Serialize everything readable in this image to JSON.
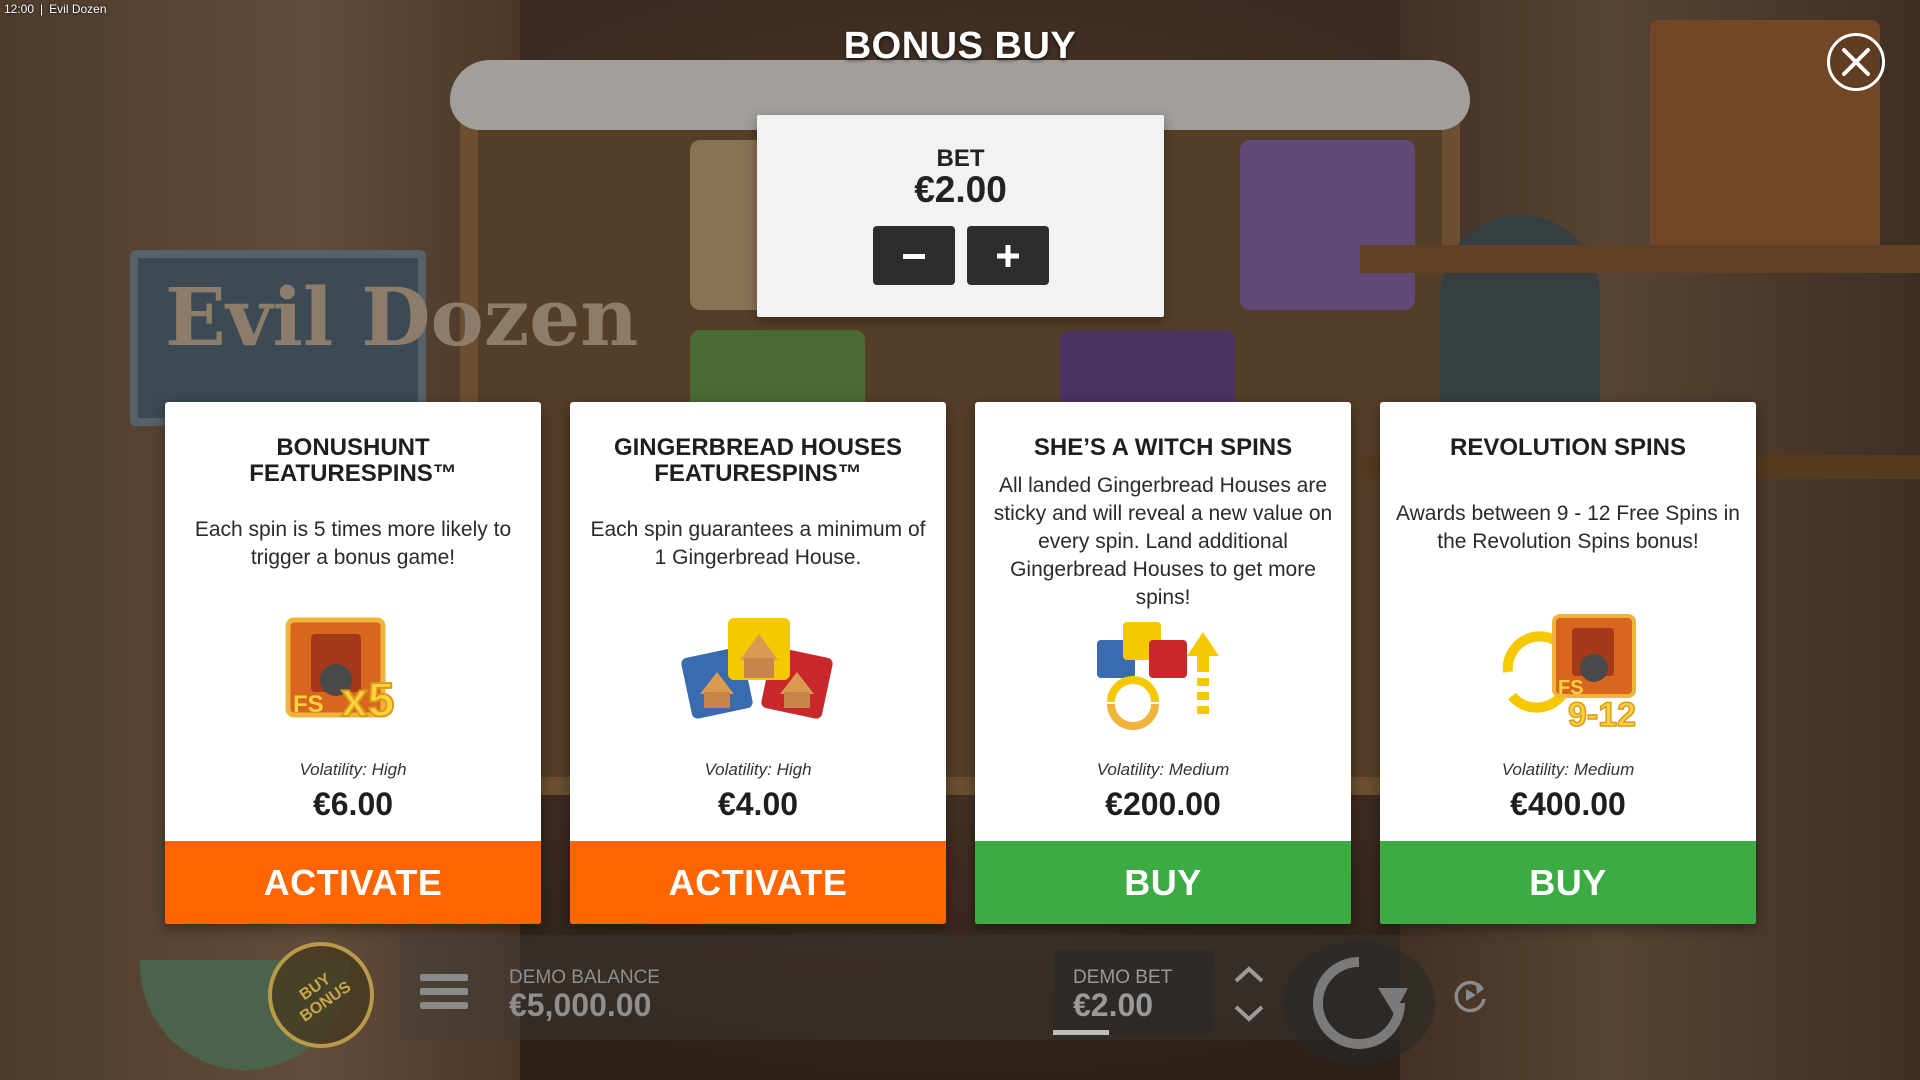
{
  "window": {
    "time": "12:00",
    "separator": "|",
    "title": "Evil Dozen"
  },
  "header": {
    "title": "BONUS BUY",
    "close_icon": "close-icon"
  },
  "bet": {
    "label": "BET",
    "value": "€2.00",
    "minus_icon": "minus-icon",
    "plus_icon": "plus-icon"
  },
  "cards": [
    {
      "title": "BONUSHUNT FEATURESPINS™",
      "description": "Each spin is 5 times more likely to trigger a bonus game!",
      "icon": "featurespins-x5-icon",
      "volatility": "Volatility: High",
      "price": "€6.00",
      "action": "ACTIVATE",
      "action_color": "#ff6500"
    },
    {
      "title": "GINGERBREAD HOUSES FEATURESPINS™",
      "description": "Each spin guarantees a minimum of 1 Gingerbread House.",
      "icon": "gingerbread-houses-icon",
      "volatility": "Volatility: High",
      "price": "€4.00",
      "action": "ACTIVATE",
      "action_color": "#ff6500"
    },
    {
      "title": "SHE’S A WITCH SPINS",
      "description": "All landed Gingerbread Houses are sticky and will reveal a new value on every spin. Land additional Gingerbread Houses to get more spins!",
      "icon": "witch-spins-icon",
      "volatility": "Volatility: Medium",
      "price": "€200.00",
      "action": "BUY",
      "action_color": "#3dab44"
    },
    {
      "title": "REVOLUTION SPINS",
      "description": "Awards between 9 - 12 Free Spins in the Revolution Spins bonus!",
      "icon": "revolution-spins-icon",
      "volatility": "Volatility: Medium",
      "price": "€400.00",
      "action": "BUY",
      "action_color": "#3dab44"
    }
  ],
  "bottom_bar": {
    "buy_bonus": "BUY\nBONUS",
    "menu_icon": "hamburger-menu-icon",
    "balance_label": "DEMO BALANCE",
    "balance_value": "€5,000.00",
    "bet_label": "DEMO BET",
    "bet_value": "€2.00",
    "arrows_icon": "bet-up-down-icon",
    "spin_icon": "spin-icon",
    "autoplay_icon": "autoplay-icon"
  },
  "background": {
    "logo_text": "Evil Dozen"
  },
  "colors": {
    "activate": "#ff6500",
    "buy": "#3dab44",
    "panel": "#f2f2f2",
    "bet_button": "#2d2d2d"
  }
}
